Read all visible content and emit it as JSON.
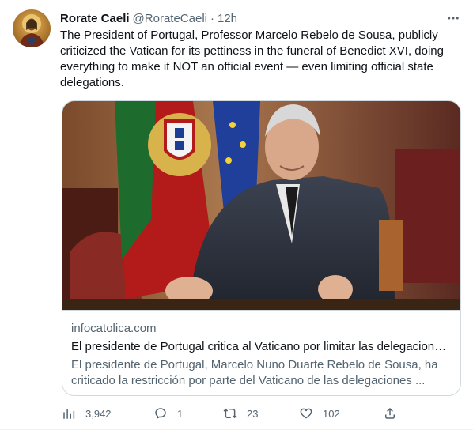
{
  "tweet": {
    "author_name": "Rorate Caeli",
    "handle": "@RorateCaeli",
    "separator": "·",
    "time": "12h",
    "text": "The President of Portugal, Professor Marcelo Rebelo de Sousa, publicly criticized the Vatican for its pettiness in the funeral of Benedict XVI, doing everything to make it NOT an official event — even limiting official state delegations."
  },
  "card": {
    "domain": "infocatolica.com",
    "title": "El presidente de Portugal critica al Vaticano por limitar las delegaciones ...",
    "description": "El presidente de Portugal, Marcelo Nuno Duarte Rebelo de Sousa, ha criticado la restricción por parte del Vaticano de las delegaciones ..."
  },
  "actions": {
    "views": "3,942",
    "replies": "1",
    "retweets": "23",
    "likes": "102"
  },
  "icons": {
    "more": "more-icon",
    "views": "analytics-icon",
    "reply": "reply-icon",
    "retweet": "retweet-icon",
    "like": "heart-icon",
    "share": "share-icon"
  },
  "colors": {
    "text": "#0f1419",
    "secondary": "#536471",
    "border": "#cfd9de"
  }
}
